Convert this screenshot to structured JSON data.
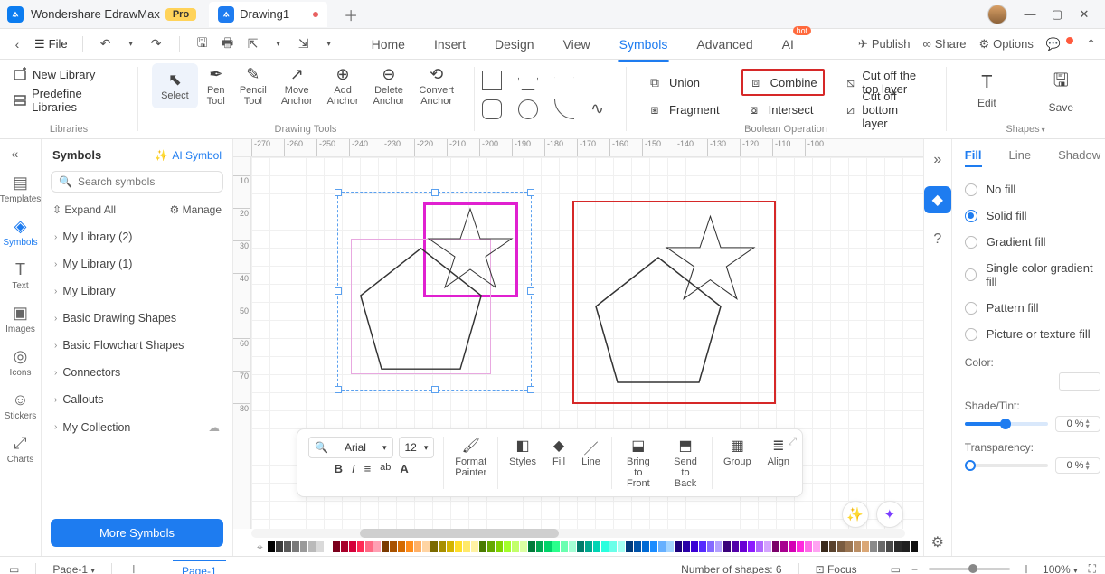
{
  "title_bar": {
    "app_name": "Wondershare EdrawMax",
    "badge": "Pro",
    "doc_name": "Drawing1"
  },
  "menu": {
    "file": "File",
    "tabs": [
      "Home",
      "Insert",
      "Design",
      "View",
      "Symbols",
      "Advanced",
      "AI"
    ],
    "active_tab": "Symbols",
    "hot": "hot",
    "right": {
      "publish": "Publish",
      "share": "Share",
      "options": "Options"
    }
  },
  "ribbon": {
    "libraries": {
      "label": "Libraries",
      "new_library": "New Library",
      "predefine": "Predefine Libraries"
    },
    "drawing": {
      "label": "Drawing Tools",
      "select": "Select",
      "pen": "Pen\nTool",
      "pencil": "Pencil\nTool",
      "move": "Move\nAnchor",
      "add": "Add\nAnchor",
      "delete": "Delete\nAnchor",
      "convert": "Convert\nAnchor"
    },
    "boolean": {
      "label": "Boolean Operation",
      "union": "Union",
      "combine": "Combine",
      "cutoff_top": "Cut off the top layer",
      "fragment": "Fragment",
      "intersect": "Intersect",
      "cutoff_bottom": "Cut off bottom layer"
    },
    "edit": "Edit",
    "save": "Save",
    "shapes": "Shapes"
  },
  "left_rail": {
    "items": [
      "Templates",
      "Symbols",
      "Text",
      "Images",
      "Icons",
      "Stickers",
      "Charts"
    ]
  },
  "symbols_panel": {
    "title": "Symbols",
    "ai_symbol": "AI Symbol",
    "search_placeholder": "Search symbols",
    "expand_all": "Expand All",
    "manage": "Manage",
    "items": [
      "My Library (2)",
      "My Library (1)",
      "My Library",
      "Basic Drawing Shapes",
      "Basic Flowchart Shapes",
      "Connectors",
      "Callouts",
      "My Collection"
    ],
    "more": "More Symbols"
  },
  "ruler_h": [
    "-270",
    "-260",
    "-250",
    "-240",
    "-230",
    "-220",
    "-210",
    "-200",
    "-190",
    "-180",
    "-170",
    "-160",
    "-150",
    "-140",
    "-130",
    "-120",
    "-110",
    "-100"
  ],
  "ruler_v": [
    "10",
    "20",
    "30",
    "40",
    "50",
    "60",
    "70",
    "80"
  ],
  "float_toolbar": {
    "font": "Arial",
    "size": "12",
    "format_painter": "Format\nPainter",
    "styles": "Styles",
    "fill": "Fill",
    "line": "Line",
    "bring_front": "Bring to\nFront",
    "send_back": "Send to\nBack",
    "group": "Group",
    "align": "Align"
  },
  "color_palette": [
    "#000000",
    "#3b3b3b",
    "#5a5a5a",
    "#7a7a7a",
    "#9a9a9a",
    "#bababa",
    "#dadada",
    "#ffffff",
    "#7b001c",
    "#a8002a",
    "#d4003a",
    "#ff2a55",
    "#ff6a85",
    "#ffa0b3",
    "#7b3a00",
    "#a85200",
    "#d46a00",
    "#ff8c1a",
    "#ffb066",
    "#ffd4a3",
    "#7b6a00",
    "#a88f00",
    "#d4b400",
    "#ffde2a",
    "#ffe96a",
    "#fff2a3",
    "#4a7b00",
    "#65a800",
    "#80d400",
    "#a3ff2a",
    "#c2ff6a",
    "#dcffa3",
    "#007b3a",
    "#00a852",
    "#00d46a",
    "#2aff8c",
    "#6affb0",
    "#a3ffd4",
    "#007b6a",
    "#00a88f",
    "#00d4b4",
    "#2affde",
    "#6affe9",
    "#a3fff2",
    "#003a7b",
    "#0052a8",
    "#006ad4",
    "#1a8cff",
    "#66b0ff",
    "#a3d4ff",
    "#1c007b",
    "#2a00a8",
    "#3a00d4",
    "#552aff",
    "#856aff",
    "#b3a0ff",
    "#3a007b",
    "#5200a8",
    "#6a00d4",
    "#8c1aff",
    "#b066ff",
    "#d4a3ff",
    "#7b006a",
    "#a8008f",
    "#d400b4",
    "#ff2ade",
    "#ff6ae9",
    "#ffa3f2",
    "#3a2a1c",
    "#5a432e",
    "#7a5c40",
    "#9a7552",
    "#ba8e64",
    "#daa776",
    "#8a8a8a",
    "#6a6a6a",
    "#4a4a4a",
    "#2a2a2a",
    "#202020",
    "#101010"
  ],
  "right_panel": {
    "tabs": [
      "Fill",
      "Line",
      "Shadow"
    ],
    "active": "Fill",
    "options": [
      "No fill",
      "Solid fill",
      "Gradient fill",
      "Single color gradient fill",
      "Pattern fill",
      "Picture or texture fill"
    ],
    "selected": "Solid fill",
    "color_label": "Color:",
    "shade_label": "Shade/Tint:",
    "transparency_label": "Transparency:",
    "shade_pct": "0 %",
    "trans_pct": "0 %"
  },
  "status": {
    "page_selector": "Page-1",
    "page_tab": "Page-1",
    "shapes_count": "Number of shapes: 6",
    "focus": "Focus",
    "zoom": "100%"
  }
}
